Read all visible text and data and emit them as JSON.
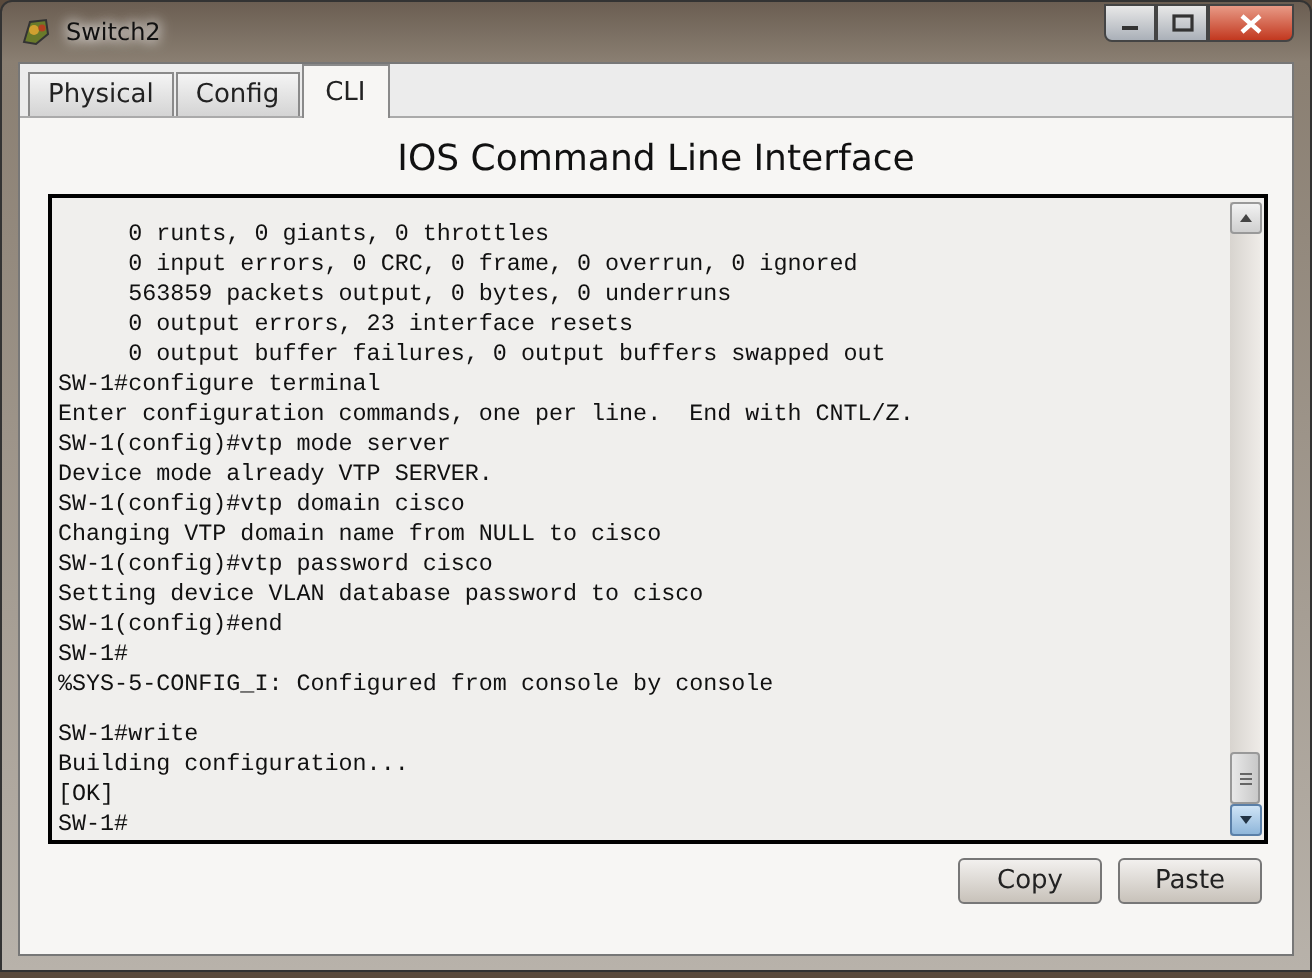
{
  "window": {
    "title": "Switch2"
  },
  "tabs": [
    {
      "label": "Physical",
      "selected": false
    },
    {
      "label": "Config",
      "selected": false
    },
    {
      "label": "CLI",
      "selected": true
    }
  ],
  "heading": "IOS Command Line Interface",
  "terminal": {
    "lines": [
      {
        "kind": "text",
        "text": "     0 runts, 0 giants, 0 throttles"
      },
      {
        "kind": "text",
        "text": "     0 input errors, 0 CRC, 0 frame, 0 overrun, 0 ignored"
      },
      {
        "kind": "text",
        "text": "     563859 packets output, 0 bytes, 0 underruns"
      },
      {
        "kind": "text",
        "text": "     0 output errors, 23 interface resets"
      },
      {
        "kind": "text",
        "text": "     0 output buffer failures, 0 output buffers swapped out"
      },
      {
        "kind": "text",
        "text": "SW-1#configure terminal"
      },
      {
        "kind": "text",
        "text": "Enter configuration commands, one per line.  End with CNTL/Z."
      },
      {
        "kind": "text",
        "text": "SW-1(config)#vtp mode server"
      },
      {
        "kind": "text",
        "text": "Device mode already VTP SERVER."
      },
      {
        "kind": "text",
        "text": "SW-1(config)#vtp domain cisco"
      },
      {
        "kind": "text",
        "text": "Changing VTP domain name from NULL to cisco"
      },
      {
        "kind": "text",
        "text": "SW-1(config)#vtp password cisco"
      },
      {
        "kind": "text",
        "text": "Setting device VLAN database password to cisco"
      },
      {
        "kind": "text",
        "text": "SW-1(config)#end"
      },
      {
        "kind": "text",
        "text": "SW-1#"
      },
      {
        "kind": "text",
        "text": "%SYS-5-CONFIG_I: Configured from console by console"
      },
      {
        "kind": "blank"
      },
      {
        "kind": "text",
        "text": "SW-1#write"
      },
      {
        "kind": "text",
        "text": "Building configuration..."
      },
      {
        "kind": "text",
        "text": "[OK]"
      },
      {
        "kind": "text",
        "text": "SW-1#"
      }
    ]
  },
  "buttons": [
    "Copy",
    "Paste"
  ]
}
